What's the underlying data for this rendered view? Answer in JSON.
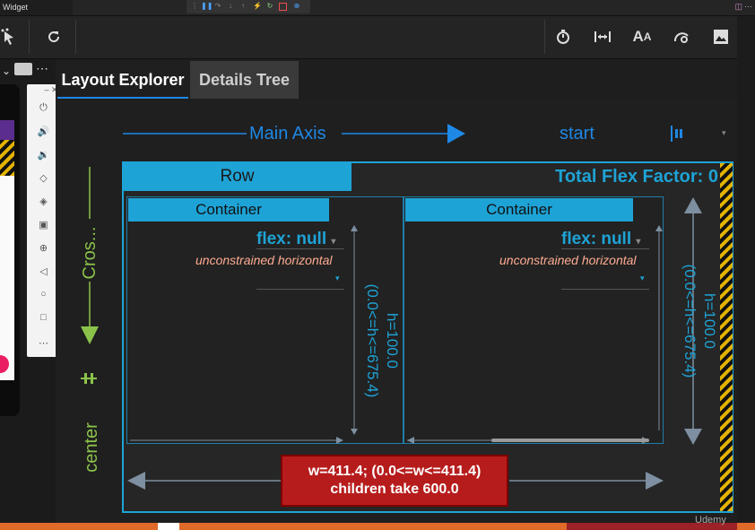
{
  "window": {
    "tab_title": "Widget Inspector",
    "tab_close": "✕"
  },
  "tabs": {
    "layout_explorer": "Layout Explorer",
    "details_tree": "Details Tree"
  },
  "main_axis": {
    "label": "Main Axis",
    "alignment": "start"
  },
  "cross_axis": {
    "label": "Cros...",
    "alignment": "center"
  },
  "row": {
    "title": "Row",
    "total_flex_factor": "Total Flex Factor: 0",
    "height_label": "h=100.0",
    "height_constraint": "(0.0<=h<=675.4)",
    "width_label": "w=411.4; (0.0<=w<=411.4)",
    "children_label": "children take 600.0"
  },
  "children": [
    {
      "title": "Container",
      "flex": "flex: null",
      "constraint": "unconstrained horizontal",
      "height_label": "h=100.0",
      "height_constraint": "(0.0<=h<=675.4)"
    },
    {
      "title": "Container",
      "flex": "flex: null",
      "constraint": "unconstrained horizontal"
    }
  ],
  "watermark": "Udemy",
  "colors": {
    "accent": "#1ea3d6",
    "cross": "#8bc34a",
    "overflow": "#b71c1c",
    "hatch": "#e3b200"
  }
}
